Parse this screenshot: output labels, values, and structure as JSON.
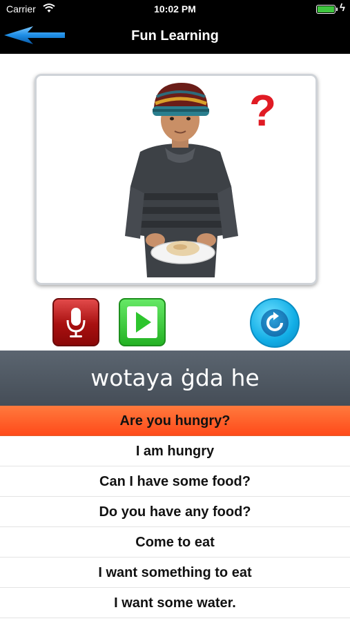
{
  "status_bar": {
    "carrier": "Carrier",
    "time": "10:02 PM"
  },
  "nav": {
    "title": "Fun Learning",
    "back_icon": "back-arrow-icon"
  },
  "image": {
    "question_mark": "?"
  },
  "controls": {
    "record_icon": "microphone-icon",
    "play_icon": "play-icon",
    "replay_icon": "replay-icon"
  },
  "phrase": {
    "text": "wotaya ġda he"
  },
  "phrases": [
    {
      "label": "Are you hungry?",
      "selected": true
    },
    {
      "label": "I am hungry",
      "selected": false
    },
    {
      "label": "Can I have some food?",
      "selected": false
    },
    {
      "label": "Do you have any food?",
      "selected": false
    },
    {
      "label": "Come to eat",
      "selected": false
    },
    {
      "label": "I want something to eat",
      "selected": false
    },
    {
      "label": "I want some water.",
      "selected": false
    }
  ],
  "colors": {
    "selected_row": "#ff5a22",
    "banner": "#4f5862",
    "accent_red": "#e01b24"
  }
}
